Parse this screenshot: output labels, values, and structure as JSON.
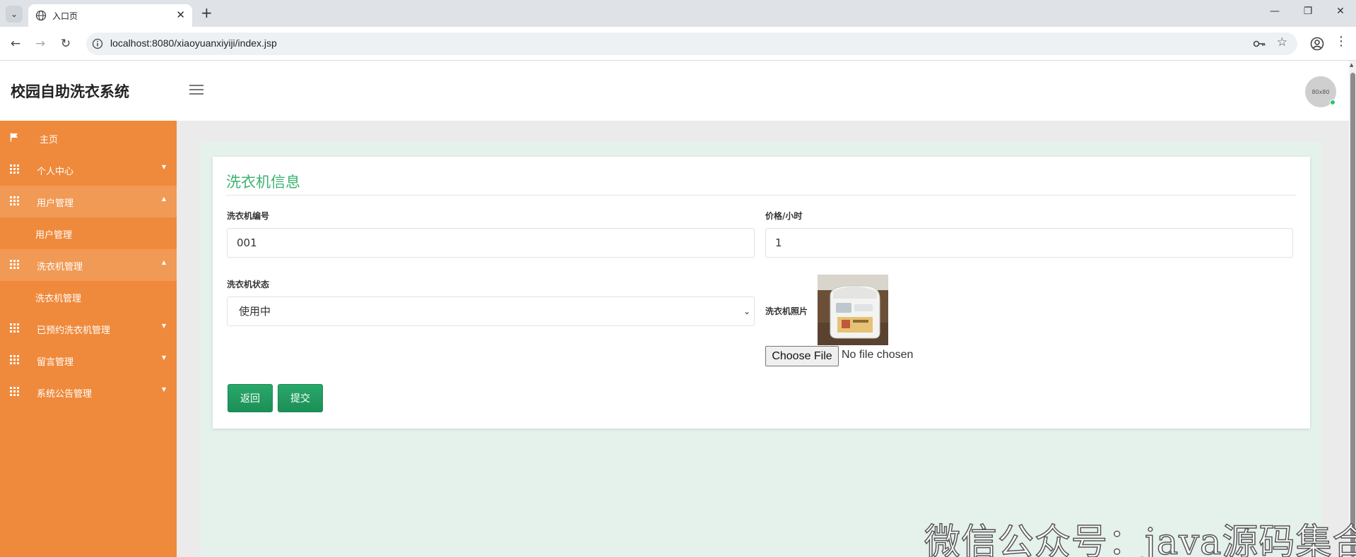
{
  "browser": {
    "tab_title": "入口页",
    "tab_close": "✕",
    "new_tab": "+",
    "url": "localhost:8080/xiaoyuanxiyiji/index.jsp",
    "win_min": "—",
    "win_restore": "❐",
    "win_close": "✕"
  },
  "app": {
    "title": "校园自助洗衣系统",
    "avatar_text": "80x80"
  },
  "sidebar": {
    "items": [
      {
        "label": "主页",
        "icon": "flag-icon"
      },
      {
        "label": "个人中心",
        "icon": "grid-icon"
      },
      {
        "label": "用户管理",
        "icon": "grid-icon",
        "expanded": true
      },
      {
        "label": "用户管理",
        "sub": true
      },
      {
        "label": "洗衣机管理",
        "icon": "grid-icon",
        "expanded": true
      },
      {
        "label": "洗衣机管理",
        "sub": true
      },
      {
        "label": "已预约洗衣机管理",
        "icon": "grid-icon"
      },
      {
        "label": "留言管理",
        "icon": "grid-icon"
      },
      {
        "label": "系统公告管理",
        "icon": "grid-icon"
      }
    ]
  },
  "form": {
    "title": "洗衣机信息",
    "number_label": "洗衣机编号",
    "number_value": "001",
    "price_label": "价格/小时",
    "price_value": "1",
    "status_label": "洗衣机状态",
    "status_value": "使用中",
    "photo_label": "洗衣机照片",
    "file_button": "Choose File",
    "file_status": "No file chosen",
    "back_button": "返回",
    "submit_button": "提交"
  },
  "watermark": "微信公众号：java源码集合",
  "colors": {
    "sidebar": "#ef8a3c",
    "accent_green": "#3cb371",
    "content_bg": "#e5f1eb"
  }
}
